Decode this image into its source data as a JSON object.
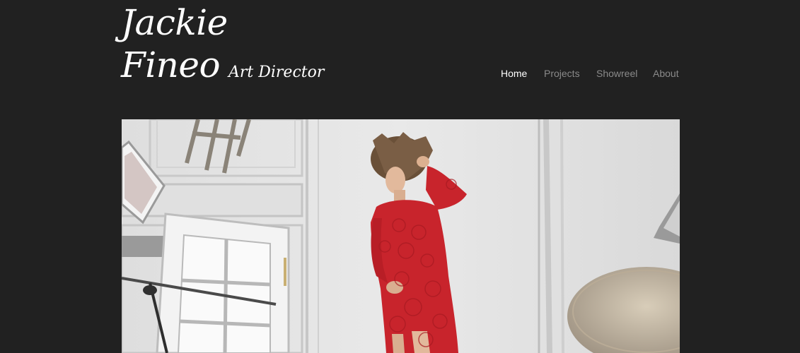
{
  "header": {
    "logo_first_name": "Jackie",
    "logo_last_name": "Fineo",
    "logo_role": "Art Director"
  },
  "nav": {
    "items": [
      {
        "label": "Home",
        "active": true
      },
      {
        "label": "Projects",
        "active": false
      },
      {
        "label": "Showreel",
        "active": false
      },
      {
        "label": "About",
        "active": false
      }
    ]
  },
  "colors": {
    "background": "#212121",
    "nav_active": "#ffffff",
    "nav_inactive": "#8a8a8a",
    "dress": "#c8242c"
  }
}
